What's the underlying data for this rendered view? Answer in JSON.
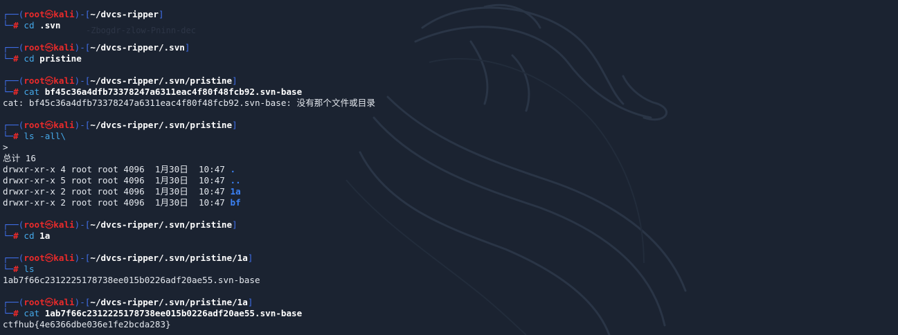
{
  "prompt": {
    "user": "root",
    "skull": "㉿",
    "host": "kali",
    "hash_symbol": "#"
  },
  "blocks": [
    {
      "path": "~/dvcs-ripper",
      "command": "cd",
      "arg": ".svn",
      "output": []
    },
    {
      "path": "~/dvcs-ripper/.svn",
      "command": "cd",
      "arg": "pristine",
      "output": []
    },
    {
      "path": "~/dvcs-ripper/.svn/pristine",
      "command": "cat",
      "arg": "bf45c36a4dfb73378247a6311eac4f80f48fcb92.svn-base",
      "output": [
        "cat: bf45c36a4dfb73378247a6311eac4f80f48fcb92.svn-base: 没有那个文件或目录"
      ]
    },
    {
      "path": "~/dvcs-ripper/.svn/pristine",
      "command": "ls",
      "arg": "-all\\",
      "output": [
        ">",
        "总计 16"
      ],
      "listing": [
        {
          "meta": "drwxr-xr-x 4 root root 4096  1月30日  10:47 ",
          "name": "."
        },
        {
          "meta": "drwxr-xr-x 5 root root 4096  1月30日  10:47 ",
          "name": ".."
        },
        {
          "meta": "drwxr-xr-x 2 root root 4096  1月30日  10:47 ",
          "name": "1a"
        },
        {
          "meta": "drwxr-xr-x 2 root root 4096  1月30日  10:47 ",
          "name": "bf"
        }
      ]
    },
    {
      "path": "~/dvcs-ripper/.svn/pristine",
      "command": "cd",
      "arg": "1a",
      "output": []
    },
    {
      "path": "~/dvcs-ripper/.svn/pristine/1a",
      "command": "ls",
      "arg": "",
      "output": [
        "1ab7f66c2312225178738ee015b0226adf20ae55.svn-base"
      ]
    },
    {
      "path": "~/dvcs-ripper/.svn/pristine/1a",
      "command": "cat",
      "arg": "1ab7f66c2312225178738ee015b0226adf20ae55.svn-base",
      "output": [
        "ctfhub{4e6366dbe036e1fe2bcda283}"
      ]
    }
  ],
  "colors": {
    "background": "#1b2331",
    "frame": "#3f6ee8",
    "user": "#ec2a2a",
    "command": "#45a8e8",
    "directory": "#3b82f6"
  }
}
